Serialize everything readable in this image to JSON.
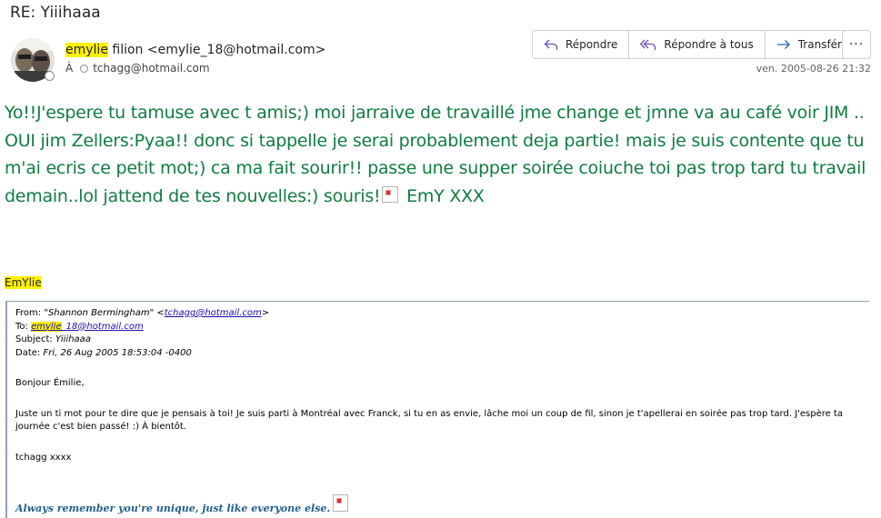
{
  "subject": "RE: Yiiihaaa",
  "sender": {
    "first_name": "emylie",
    "rest": " filion <emylie_18@hotmail.com>"
  },
  "recipient": {
    "label": "À",
    "address": "tchagg@hotmail.com"
  },
  "actions": {
    "reply": "Répondre",
    "reply_all": "Répondre à tous",
    "forward": "Transférer",
    "more": "···"
  },
  "date": "ven. 2005-08-26 21:32",
  "body": {
    "text": "Yo!!J'espere tu tamuse avec t amis;) moi jarraive de travaillé jme change et jmne va au café voir JIM .. OUI jim Zellers:Pyaa!! donc si tappelle je serai probablement deja partie! mais je suis contente que tu m'ai ecris ce petit mot;) ca ma fait sourir!! passe une supper soirée coiuche toi pas trop tard tu travail demain..lol jattend de tes nouvelles:) souris!",
    "closing": "EmY XXX"
  },
  "signature": "EmYlie",
  "quoted": {
    "from_label": "From:",
    "from_name": "\"Shannon Bermingham\" <",
    "from_email": "tchagg@hotmail.com",
    "from_end": ">",
    "to_label": "To:",
    "to_hl": "emylie",
    "to_rest": "_18@hotmail.com",
    "subject_label": "Subject:",
    "subject_value": "Yiiihaaa",
    "date_label": "Date:",
    "date_value": "Fri, 26 Aug 2005 18:53:04 -0400",
    "greeting": "Bonjour Émilie,",
    "message": "Juste un ti mot pour te dire que je pensais à toi! Je suis parti à Montréal avec Franck, si tu en as envie, lâche moi un coup de fil, sinon je t'apellerai en soirée pas trop tard. J'espère ta journée c'est bien passé! :) À bientôt.",
    "sign": "tchagg xxxx",
    "motto": "Always remember you're unique, just like everyone else."
  }
}
